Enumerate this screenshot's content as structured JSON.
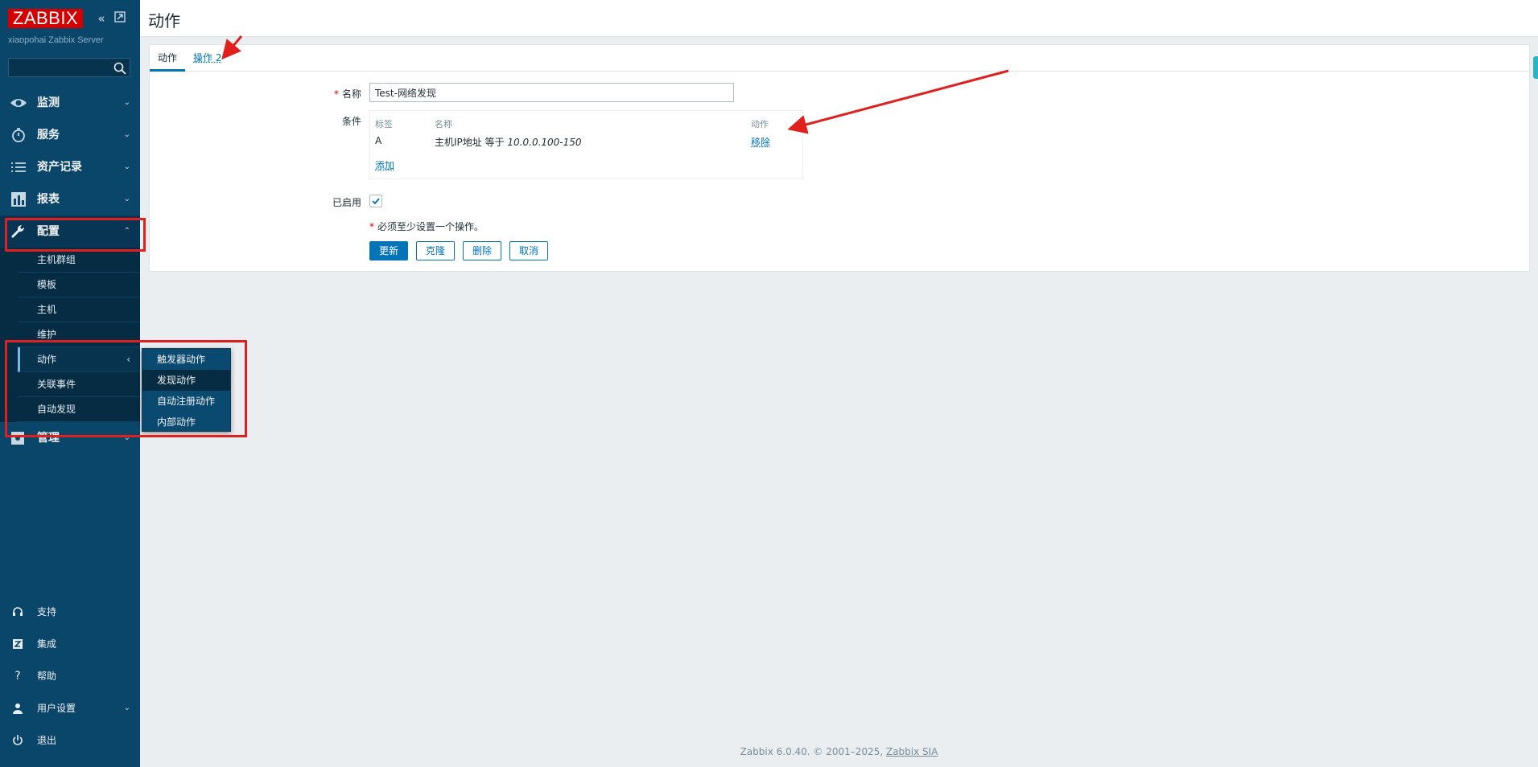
{
  "sidebar": {
    "logo": "ZABBIX",
    "server_name": "xiaopohai Zabbix Server",
    "search_placeholder": "",
    "nav": [
      {
        "label": "监测",
        "icon": "eye-icon"
      },
      {
        "label": "服务",
        "icon": "stopwatch-icon"
      },
      {
        "label": "资产记录",
        "icon": "list-icon"
      },
      {
        "label": "报表",
        "icon": "bar-chart-icon"
      },
      {
        "label": "配置",
        "icon": "wrench-icon"
      },
      {
        "label": "管理",
        "icon": "admin-gear-icon"
      }
    ],
    "config_submenu": [
      "主机群组",
      "模板",
      "主机",
      "维护",
      "动作",
      "关联事件",
      "自动发现"
    ],
    "actions_flyout": [
      "触发器动作",
      "发现动作",
      "自动注册动作",
      "内部动作"
    ],
    "bottom": [
      {
        "label": "支持",
        "icon": "headset-icon"
      },
      {
        "label": "集成",
        "icon": "integration-icon"
      },
      {
        "label": "帮助",
        "icon": "help-icon"
      },
      {
        "label": "用户设置",
        "icon": "user-icon"
      },
      {
        "label": "退出",
        "icon": "power-icon"
      }
    ]
  },
  "header": {
    "title": "动作"
  },
  "tabs": [
    {
      "label": "动作",
      "active": true
    },
    {
      "label": "操作 2",
      "active": false
    }
  ],
  "form": {
    "name_label": "名称",
    "name_value": "Test-网络发现",
    "conditions_label": "条件",
    "conditions_headers": {
      "tag": "标签",
      "name": "名称",
      "action": "动作"
    },
    "condition_row": {
      "tag": "A",
      "name_prefix": "主机IP地址 等于 ",
      "name_value": "10.0.0.100-150",
      "action": "移除"
    },
    "add_link": "添加",
    "enabled_label": "已启用",
    "enabled": true,
    "note": "必须至少设置一个操作。",
    "buttons": {
      "update": "更新",
      "clone": "克隆",
      "delete": "删除",
      "cancel": "取消"
    }
  },
  "footer": {
    "text": "Zabbix 6.0.40. © 2001–2025, ",
    "link": "Zabbix SIA"
  },
  "colors": {
    "sidebar": "#0a466a",
    "accent": "#0275b8",
    "logo": "#d40000",
    "annotation": "#e01f1f"
  }
}
